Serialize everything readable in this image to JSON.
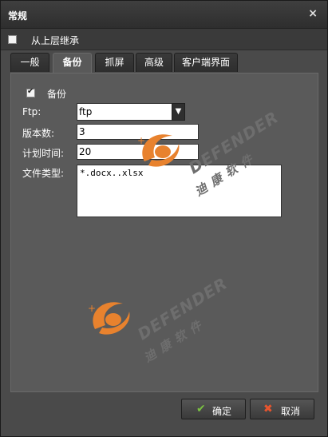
{
  "dialog": {
    "title": "常规",
    "close_glyph": "×"
  },
  "inherit": {
    "label": "从上层继承",
    "checked": false
  },
  "tabs": [
    {
      "label": "一般",
      "active": false
    },
    {
      "label": "备份",
      "active": true
    },
    {
      "label": "抓屏",
      "active": false
    },
    {
      "label": "高级",
      "active": false
    },
    {
      "label": "客户端界面",
      "active": false
    }
  ],
  "backup": {
    "label": "备份",
    "checked": true
  },
  "form": {
    "ftp_label": "Ftp:",
    "ftp_value": "ftp",
    "versions_label": "版本数:",
    "versions_value": "3",
    "schedule_label": "计划时间:",
    "schedule_value": "20",
    "filetype_label": "文件类型:",
    "filetype_value": "*.docx..xlsx"
  },
  "watermark": {
    "brand": "DEFENDER",
    "cn": "迪 康 软 件",
    "accent_color": "#e8822e"
  },
  "footer": {
    "ok_label": "确定",
    "cancel_label": "取消",
    "ok_icon_color": "#7ac142",
    "cancel_icon_color": "#e8552e"
  }
}
